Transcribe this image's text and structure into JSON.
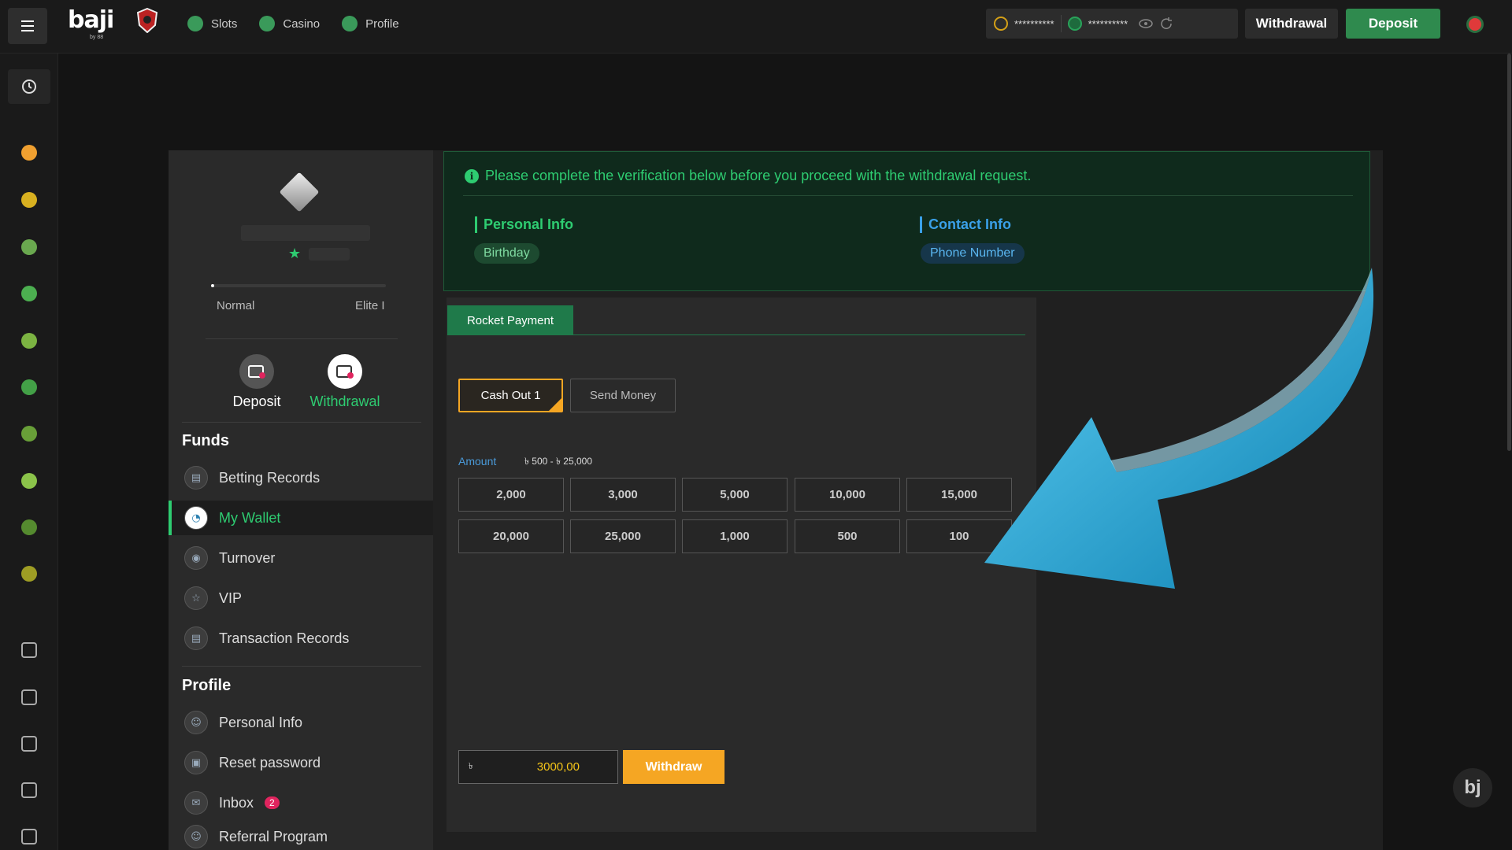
{
  "header": {
    "logo": "baji",
    "logo_sub": "by 88",
    "nav": [
      {
        "label": "Slots",
        "icon": "slots-icon",
        "color": "#3a9a5a"
      },
      {
        "label": "Casino",
        "icon": "spade-icon",
        "color": "#3a9a5a"
      },
      {
        "label": "Profile",
        "icon": "profile-icon",
        "color": "#3a9a5a"
      }
    ],
    "balance_main": "**********",
    "balance_bonus": "**********",
    "withdrawal_btn": "Withdrawal",
    "deposit_btn": "Deposit"
  },
  "sidebar": {
    "icons": [
      "history-icon",
      "star-icon",
      "crown-icon",
      "sports-icon",
      "spade-icon",
      "slots-icon",
      "fish-icon",
      "cockfight-icon",
      "lottery-icon",
      "arcade-icon",
      "ball-icon",
      "gift-icon",
      "vip-icon",
      "users-icon",
      "affiliate-icon",
      "badge-icon"
    ]
  },
  "profile": {
    "level_left": "Normal",
    "level_right": "Elite I",
    "progress": 0.02,
    "deposit_label": "Deposit",
    "withdrawal_label": "Withdrawal",
    "funds_heading": "Funds",
    "funds_items": [
      "Betting Records",
      "My Wallet",
      "Turnover",
      "VIP",
      "Transaction Records"
    ],
    "profile_heading": "Profile",
    "profile_items": [
      "Personal Info",
      "Reset password",
      "Inbox",
      "Referral Program"
    ],
    "inbox_badge": "2"
  },
  "verification": {
    "message": "Please complete the verification below before you proceed with the withdrawal request.",
    "personal_heading": "Personal Info",
    "personal_item": "Birthday",
    "contact_heading": "Contact Info",
    "contact_item": "Phone Number"
  },
  "withdraw": {
    "tab": "Rocket Payment",
    "option_selected": "Cash Out 1",
    "option_other": "Send Money",
    "amount_label": "Amount",
    "amount_range": "৳ 500 - ৳ 25,000",
    "amounts_row1": [
      "2,000",
      "3,000",
      "5,000",
      "10,000",
      "15,000"
    ],
    "amounts_row2": [
      "20,000",
      "25,000",
      "1,000",
      "500",
      "100"
    ],
    "currency": "৳",
    "input_value": "3000,00",
    "submit": "Withdraw"
  },
  "colors": {
    "accent": "#2ecc71",
    "brand_green": "#2f8a4e",
    "warning": "#f5a623",
    "arrow": "#1fa3d4"
  }
}
